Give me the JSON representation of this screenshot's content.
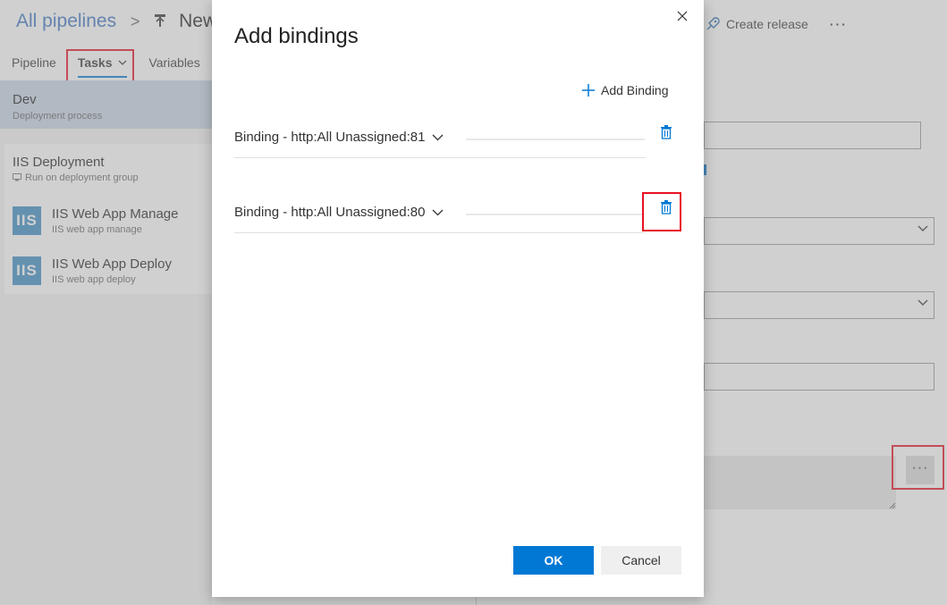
{
  "header": {
    "breadcrumb": "All pipelines",
    "separator": ">",
    "pipeline_name": "New r",
    "create_release": "Create release",
    "more": "···"
  },
  "tabs": [
    {
      "label": "Pipeline"
    },
    {
      "label": "Tasks",
      "active": true
    },
    {
      "label": "Variables"
    }
  ],
  "tasks_chevron": "chevron-down-icon",
  "stage": {
    "title": "Dev",
    "subtitle": "Deployment process"
  },
  "phase": {
    "title": "IIS Deployment",
    "subtitle": "Run on deployment group"
  },
  "task_list": [
    {
      "icon_text": "IIS",
      "title": "IIS Web App Manage",
      "subtitle": "IIS web app manage"
    },
    {
      "icon_text": "IIS",
      "title": "IIS Web App Deploy",
      "subtitle": "IIS web app deploy"
    }
  ],
  "right_panel": {
    "ellipsis_button": "···"
  },
  "dialog": {
    "title": "Add bindings",
    "add_binding_label": "Add Binding",
    "bindings": [
      {
        "label": "Binding - http:All Unassigned:81"
      },
      {
        "label": "Binding - http:All Unassigned:80"
      }
    ],
    "ok_label": "OK",
    "cancel_label": "Cancel"
  },
  "colors": {
    "accent": "#0078d4",
    "highlight": "#e81123",
    "task_icon_bg": "#3b8cc4"
  }
}
